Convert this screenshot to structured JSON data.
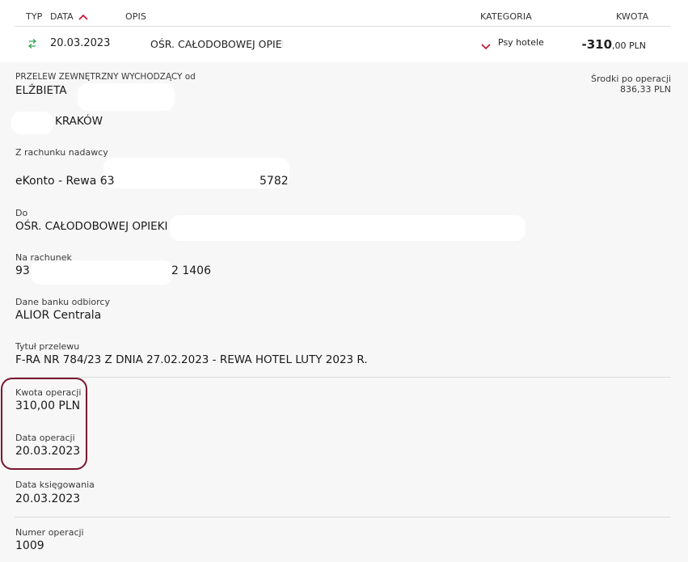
{
  "table_header": {
    "typ": "TYP",
    "data": "DATA",
    "opis": "OPIS",
    "kategoria": "KATEGORIA",
    "kwota": "KWOTA"
  },
  "transaction": {
    "date": "20.03.2023",
    "description": "OŚR. CAŁODOBOWEJ OPIEKI",
    "category": "Psy hotele",
    "amount_main": "-310",
    "amount_decimal": ",00 PLN"
  },
  "details": {
    "transfer_type_label": "PRZELEW ZEWNĘTRZNY WYCHODZĄCY od",
    "sender_name": "ELŻBIETA",
    "sender_city": "KRAKÓW",
    "balance_label": "Środki po operacji",
    "balance_value": "836,33 PLN",
    "from_account_label": "Z rachunku nadawcy",
    "from_account_name": "eKonto - Rewa 63",
    "from_account_suffix": "5782",
    "to_label": "Do",
    "to_value": "OŚR. CAŁODOBOWEJ OPIEKI",
    "to_account_label": "Na rachunek",
    "to_account_prefix": "93",
    "to_account_suffix": "2 1406",
    "bank_label": "Dane banku odbiorcy",
    "bank_value": "ALIOR Centrala",
    "title_label": "Tytuł przelewu",
    "title_value": "F-RA NR 784/23 Z DNIA 27.02.2023 - REWA HOTEL LUTY 2023 R.",
    "amount_label": "Kwota operacji",
    "amount_value": "310,00 PLN",
    "op_date_label": "Data operacji",
    "op_date_value": "20.03.2023",
    "booking_date_label": "Data księgowania",
    "booking_date_value": "20.03.2023",
    "op_number_label": "Numer operacji",
    "op_number_value": "1009"
  },
  "colors": {
    "accent": "#c8102e",
    "transfer_icon": "#3aa35a",
    "highlight_border": "#7a1530"
  }
}
